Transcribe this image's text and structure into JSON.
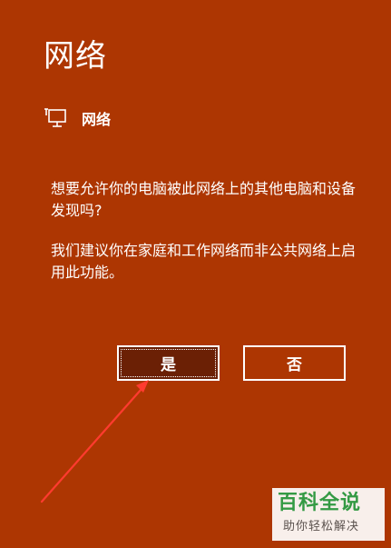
{
  "dialog": {
    "title": "网络",
    "network_icon": "network-monitor-icon",
    "network_name": "网络",
    "message_1": "想要允许你的电脑被此网络上的其他电脑和设备发现吗?",
    "message_2": "我们建议你在家庭和工作网络而非公共网络上启用此功能。",
    "yes_label": "是",
    "no_label": "否"
  },
  "watermark": {
    "main": "百科全说",
    "sub": "助你轻松解决"
  },
  "colors": {
    "background": "#ad3602",
    "yes_button_fill": "#6b2005",
    "arrow": "#ff3b2f",
    "watermark_text": "#2aa34a"
  }
}
